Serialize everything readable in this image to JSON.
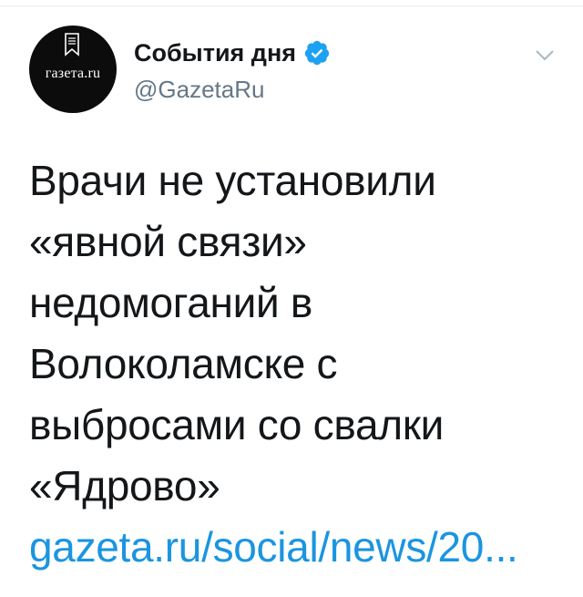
{
  "tweet": {
    "avatar": {
      "logo_text": "газета.ru",
      "icon": "bookmark-icon"
    },
    "user": {
      "display_name": "События дня",
      "verified_icon": "verified-badge-icon",
      "handle": "@GazetaRu"
    },
    "menu_icon": "chevron-down-icon",
    "text_lines": [
      "Врачи не установили",
      "«явной связи»",
      "недомоганий в",
      "Волоколамске с",
      "выбросами со свалки",
      "«Ядрово»"
    ],
    "link": "gazeta.ru/social/news/20..."
  },
  "colors": {
    "text": "#14171a",
    "secondary": "#657786",
    "link": "#1b95e0",
    "verified": "#1da1f2",
    "avatar_bg": "#0c0c0c"
  }
}
